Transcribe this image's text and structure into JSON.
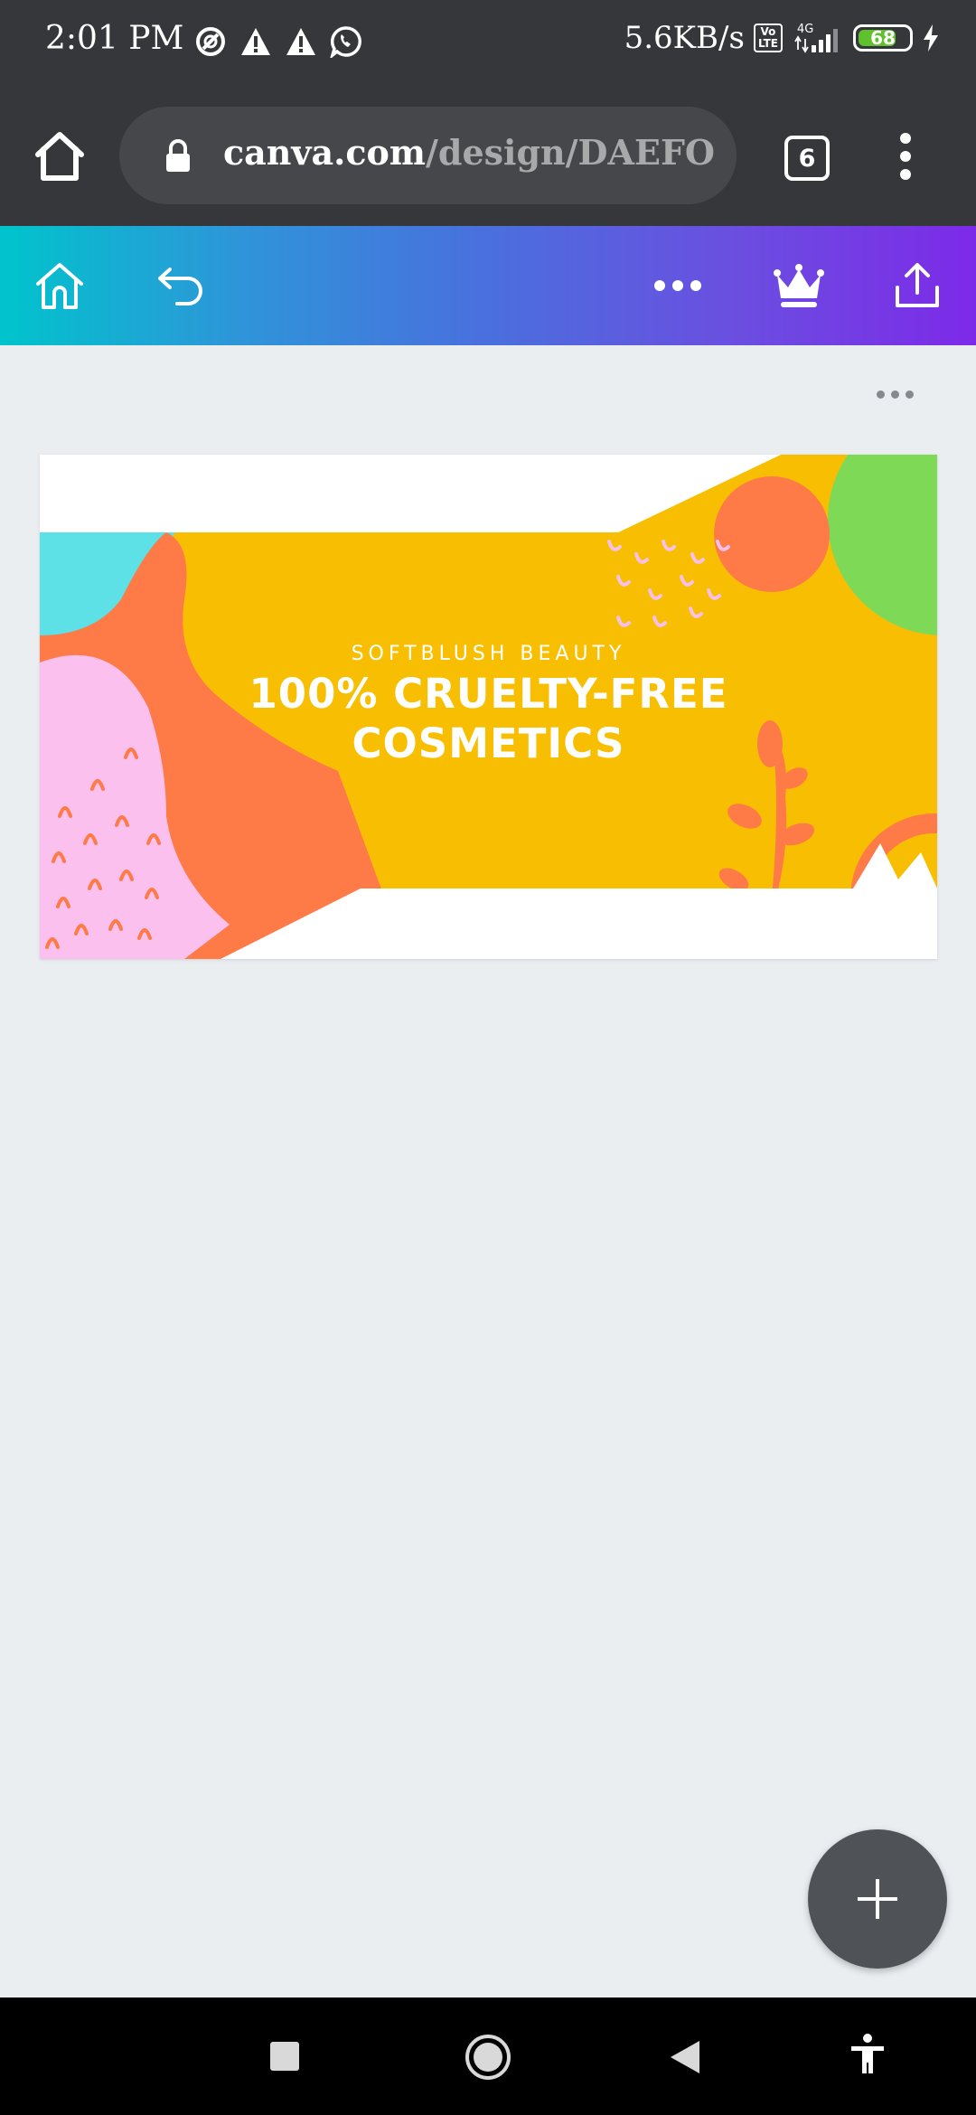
{
  "status_bar": {
    "time": "2:01 PM",
    "network_speed": "5.6KB/s",
    "volte_label": "Vo\nLTE",
    "network_type": "4G",
    "battery_level": "68",
    "icons": [
      "data-saver-icon",
      "warning-icon",
      "warning-icon",
      "whatsapp-icon",
      "signal-icon",
      "charging-icon"
    ]
  },
  "browser": {
    "url_host": "canva.com",
    "url_path": "/design/DAEFO",
    "tab_count": "6",
    "icons": [
      "home-icon",
      "lock-icon",
      "tab-switcher-icon",
      "overflow-menu-icon"
    ]
  },
  "toolbar": {
    "icons": [
      "home-icon",
      "undo-icon",
      "more-icon",
      "crown-icon",
      "share-icon"
    ],
    "gradient_start": "#00c4cc",
    "gradient_end": "#7d2ae8"
  },
  "design": {
    "subtitle": "SOFTBLUSH BEAUTY",
    "title_line1": "100% CRUELTY-FREE",
    "title_line2": "COSMETICS",
    "colors": {
      "yellow": "#f8bf02",
      "orange": "#fe7b48",
      "pink": "#fcc0ef",
      "teal": "#5de0e6",
      "green": "#7ed957"
    }
  },
  "fab": {
    "icon": "plus-icon"
  },
  "nav_bar": {
    "icons": [
      "recents-icon",
      "home-icon",
      "back-icon",
      "accessibility-icon"
    ]
  }
}
